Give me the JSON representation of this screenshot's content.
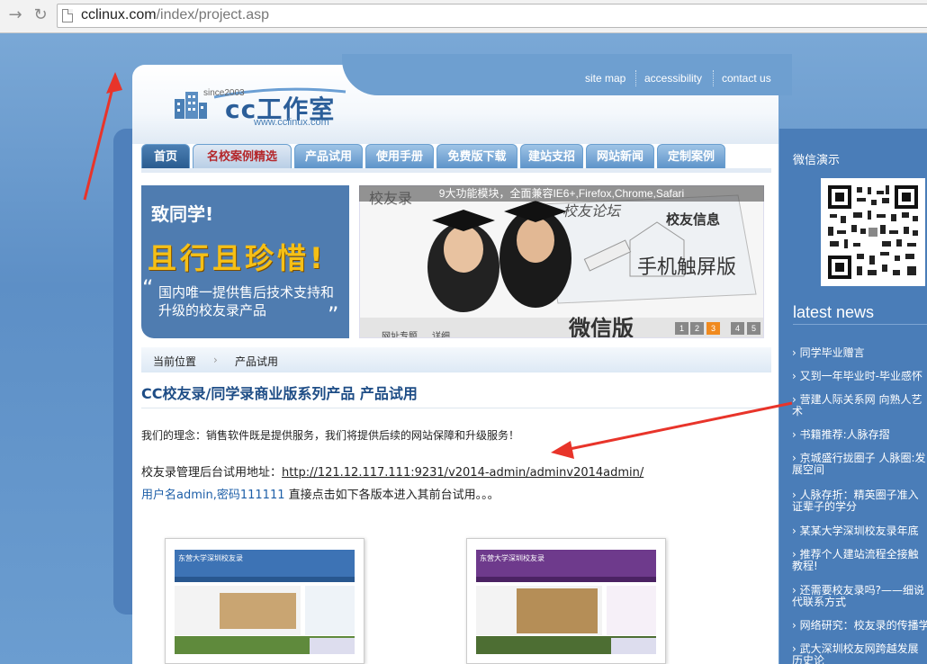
{
  "browser": {
    "url_host": "cclinux.com",
    "url_path": "/index/project.asp"
  },
  "header": {
    "links": [
      "site map",
      "accessibility",
      "contact us"
    ],
    "logo_since": "since2003",
    "logo_text": "cc工作室",
    "logo_url": "www.cclinux.com"
  },
  "nav": {
    "tabs": [
      "首页",
      "名校案例精选",
      "产品试用",
      "使用手册",
      "免费版下载",
      "建站支招",
      "网站新闻",
      "定制案例"
    ]
  },
  "banner": {
    "left_line1": "致同学!",
    "left_line2": "且行且珍惜!",
    "left_line3": "国内唯一提供售后技术支持和升级的校友录产品",
    "caption": "9大功能模块，全面兼容IE6+,Firefox,Chrome,Safari",
    "overlay_texts": [
      "校友论坛",
      "校友信息",
      "手机触屏版",
      "微信版",
      "校友录",
      "网址专题",
      "详细"
    ],
    "pages": [
      "1",
      "2",
      "3",
      "4",
      "5"
    ],
    "active_page": "3"
  },
  "breadcrumb": {
    "label": "当前位置",
    "current": "产品试用"
  },
  "main": {
    "title": "CC校友录/同学录商业版系列产品 产品试用",
    "p1": "我们的理念：销售软件既是提供服务，我们将提供后续的网站保障和升级服务！",
    "p2_prefix": "校友录管理后台试用地址：",
    "p2_link": "http://121.12.117.111:9231/v2014-admin/adminv2014admin/",
    "p3_blue": "用户名admin,密码111111",
    "p3_rest": " 直接点击如下各版本进入其前台试用。。。",
    "thumb1_title": "东营大学深圳校友录",
    "thumb2_title": "东营大学深圳校友录"
  },
  "sidebar": {
    "wechat_title": "微信演示",
    "latest_title": "latest news",
    "items": [
      "同学毕业赠言",
      "又到一年毕业时-毕业感怀",
      "营建人际关系网  向熟人艺术",
      "书籍推荐:人脉存摺",
      "京城盛行拢圈子 人脉圈:发展空间",
      "人脉存折：精英圈子准入证辈子的学分",
      "某某大学深圳校友录年底",
      "推荐个人建站流程全接触教程!",
      "还需要校友录吗?——细说代联系方式",
      "网络研究：校友录的传播学",
      "武大深圳校友网跨越发展历史论"
    ]
  },
  "colors": {
    "accent": "#2b5e99",
    "background": "#6e9fd0",
    "sidebar": "#4a7db8",
    "annotation": "#e8342a"
  }
}
